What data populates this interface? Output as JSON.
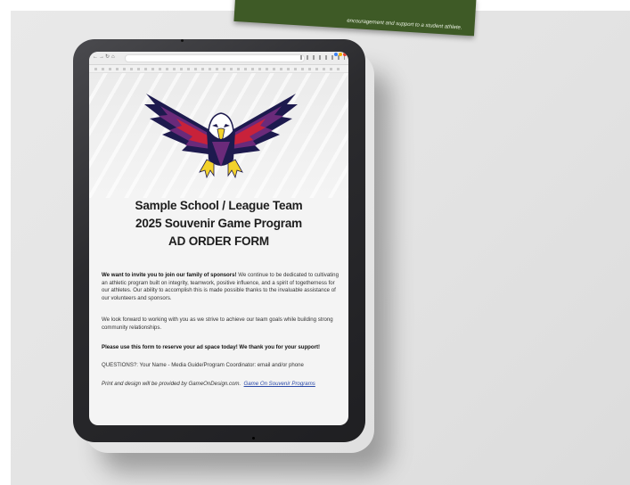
{
  "header_card": {
    "line1": "encouragement and support to a student athlete."
  },
  "form": {
    "title_line1": "Sample School / League Team",
    "title_line2": "2025 Souvenir Game Program",
    "title_line3": "AD ORDER FORM",
    "invite_bold": "We want to invite you to join our family of sponsors!",
    "invite_text": "We continue to be dedicated to cultivating an athletic program built on integrity, teamwork, positive influence, and a spirit of togetherness for our athletes. Our ability to accomplish this is made possible thanks to the invaluable assistance of our volunteers and sponsors.",
    "look_forward": "We look forward to working with you as we strive to achieve our team goals while building strong community relationships.",
    "cta": "Please use this form to reserve your ad space today!  We thank you for your support!",
    "questions": "QUESTIONS?:  Your Name - Media Guide/Program Coordinator: email and/or phone",
    "credit_text": "Print and design will be provided by GameOnDesign.com.",
    "credit_link": "Game On Souvenir Programs"
  },
  "colors": {
    "eagle_navy": "#1d1a4e",
    "eagle_purple": "#6a2a7a",
    "eagle_red": "#c8223a",
    "eagle_yellow": "#f3d22b",
    "card_green": "#3e5a26"
  },
  "icons": {
    "logo": "eagle-mascot-icon"
  }
}
